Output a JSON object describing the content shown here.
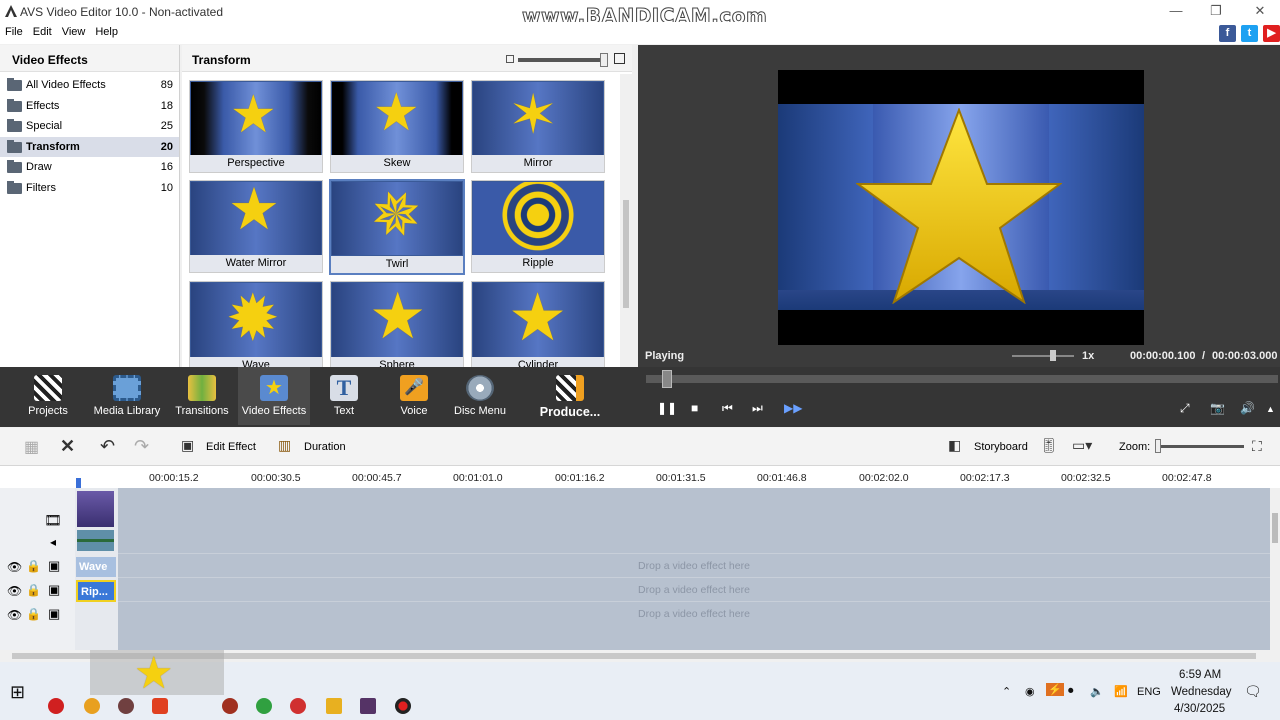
{
  "window": {
    "title": "AVS Video Editor 10.0 - Non-activated",
    "watermark": "www.BANDICAM.com"
  },
  "menu": [
    "File",
    "Edit",
    "View",
    "Help"
  ],
  "left_panel": {
    "title": "Video Effects",
    "categories": [
      {
        "label": "All Video Effects",
        "count": "89"
      },
      {
        "label": "Effects",
        "count": "18"
      },
      {
        "label": "Special",
        "count": "25"
      },
      {
        "label": "Transform",
        "count": "20"
      },
      {
        "label": "Draw",
        "count": "16"
      },
      {
        "label": "Filters",
        "count": "10"
      }
    ]
  },
  "mid_panel": {
    "title": "Transform",
    "effects": [
      "Perspective",
      "Skew",
      "Mirror",
      "Water Mirror",
      "Twirl",
      "Ripple",
      "Wave",
      "Sphere",
      "Cylinder"
    ]
  },
  "preview": {
    "status": "Playing",
    "speed": "1x",
    "time_current": "00:00:00.100",
    "time_sep": "/",
    "time_total": "00:00:03.000"
  },
  "toolbar": [
    {
      "label": "Projects",
      "icon": "clapper-icon"
    },
    {
      "label": "Media Library",
      "icon": "film-icon"
    },
    {
      "label": "Transitions",
      "icon": "transitions-icon"
    },
    {
      "label": "Video Effects",
      "icon": "star-icon"
    },
    {
      "label": "Text",
      "icon": "text-icon"
    },
    {
      "label": "Voice",
      "icon": "microphone-icon"
    },
    {
      "label": "Disc Menu",
      "icon": "disc-icon"
    },
    {
      "label": "Produce...",
      "icon": "produce-icon"
    }
  ],
  "edit_toolbar": {
    "edit_effect": "Edit Effect",
    "duration": "Duration",
    "storyboard": "Storyboard",
    "zoom": "Zoom:"
  },
  "ruler_ticks": [
    "00:00:15.2",
    "00:00:30.5",
    "00:00:45.7",
    "00:01:01.0",
    "00:01:16.2",
    "00:01:31.5",
    "00:01:46.8",
    "00:02:02.0",
    "00:02:17.3",
    "00:02:32.5",
    "00:02:47.8"
  ],
  "timeline": {
    "clip_wave": "Wave",
    "clip_ripple": "Rip...",
    "drop_hint": "Drop a video effect here"
  },
  "taskbar": {
    "time": "6:59 AM",
    "day": "Wednesday",
    "date": "4/30/2025",
    "lang": "ENG"
  },
  "colors": {
    "accent": "#5a7fc0",
    "toolbar_bg": "#353535",
    "preview_bg": "#3b3b3b",
    "star": "#f5d010"
  }
}
